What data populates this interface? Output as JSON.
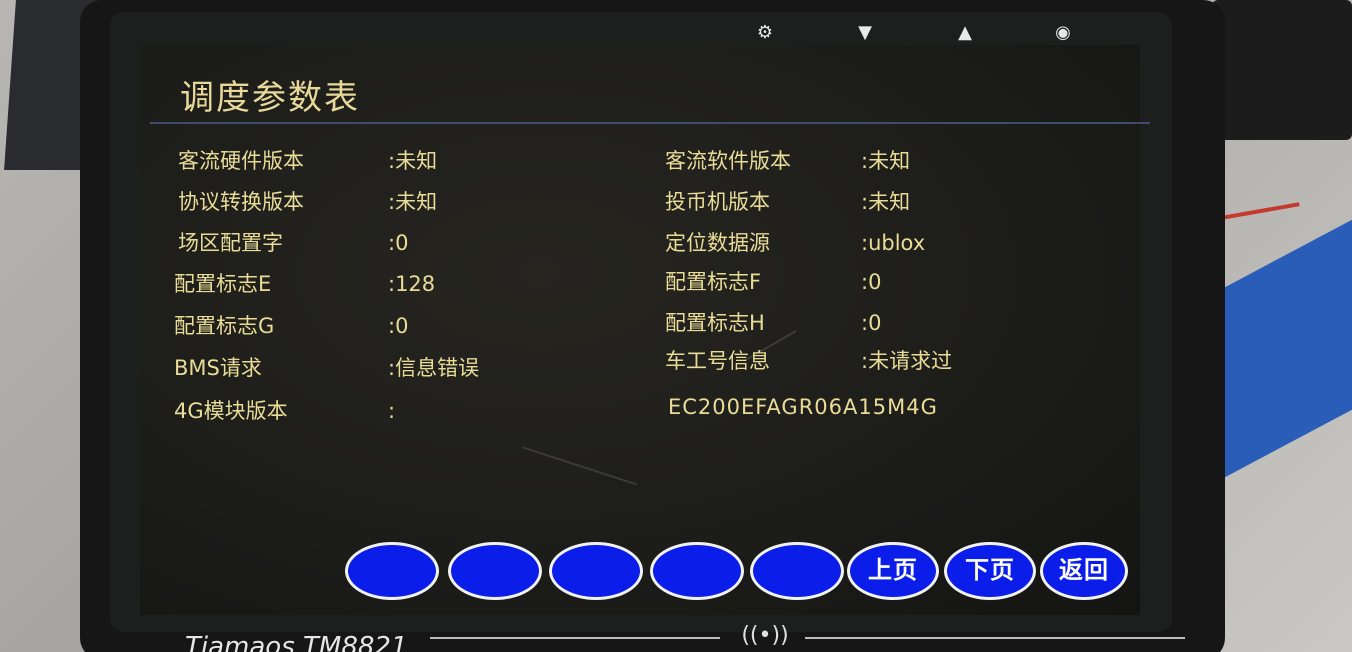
{
  "screen": {
    "title": "调度参数表",
    "top_icons": [
      "gear-icon",
      "triangle-down-icon",
      "triangle-up-icon",
      "circle-dot-icon"
    ],
    "left_fields": [
      {
        "label": "客流硬件版本",
        "value": ":未知"
      },
      {
        "label": "协议转换版本",
        "value": ":未知"
      },
      {
        "label": "场区配置字",
        "value": ":0"
      },
      {
        "label": "配置标志E",
        "value": ":128"
      },
      {
        "label": "配置标志G",
        "value": ":0"
      },
      {
        "label": "BMS请求",
        "value": ":信息错误"
      },
      {
        "label": "4G模块版本",
        "value": ":"
      }
    ],
    "right_fields": [
      {
        "label": "客流软件版本",
        "value": ":未知"
      },
      {
        "label": "投币机版本",
        "value": ":未知"
      },
      {
        "label": "定位数据源",
        "value": ":ublox"
      },
      {
        "label": "配置标志F",
        "value": ":0"
      },
      {
        "label": "配置标志H",
        "value": ":0"
      },
      {
        "label": "车工号信息",
        "value": ":未请求过"
      }
    ],
    "module_version_value": "EC200EFAGR06A15M4G",
    "buttons": [
      {
        "label": ""
      },
      {
        "label": ""
      },
      {
        "label": ""
      },
      {
        "label": ""
      },
      {
        "label": ""
      },
      {
        "label": "上页"
      },
      {
        "label": "下页"
      },
      {
        "label": "返回"
      }
    ]
  },
  "device": {
    "brand": "Tiamaos TM8821"
  },
  "colors": {
    "text": "#e9dc97",
    "button_fill": "#0b1de8",
    "button_border": "#f2f2f2",
    "screen_bg": "#1c1c19"
  }
}
